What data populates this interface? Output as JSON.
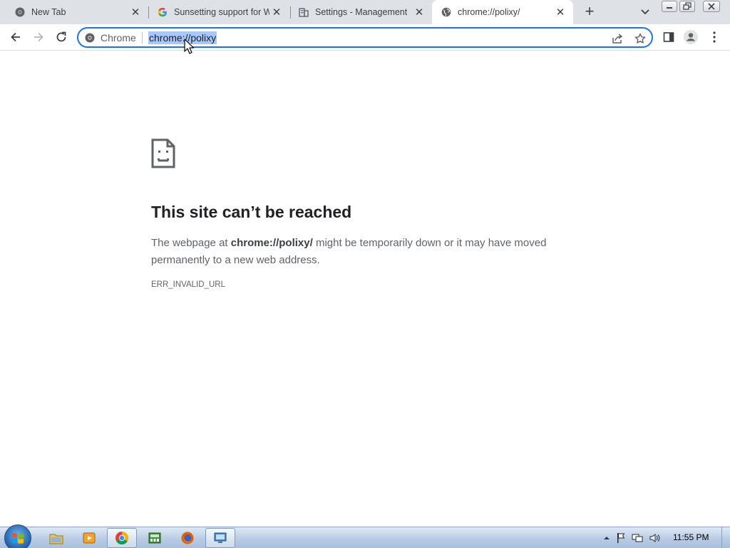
{
  "browser": {
    "tabs": [
      {
        "title": "New Tab",
        "icon": "chrome-icon",
        "active": false
      },
      {
        "title": "Sunsetting support for W",
        "icon": "google-icon",
        "active": false
      },
      {
        "title": "Settings - Management",
        "icon": "building-icon",
        "active": false
      },
      {
        "title": "chrome://polixy/",
        "icon": "globe-icon",
        "active": true
      }
    ],
    "omnibox": {
      "chip_label": "Chrome",
      "url": "chrome://polixy"
    }
  },
  "page": {
    "title": "This site can’t be reached",
    "desc_prefix": "The webpage at ",
    "desc_url": "chrome://polixy/",
    "desc_suffix": " might be temporarily down or it may have moved permanently to a new web address.",
    "error_code": "ERR_INVALID_URL"
  },
  "taskbar": {
    "apps": [
      "explorer-icon",
      "media-player-icon",
      "chrome-icon",
      "calculator-icon",
      "firefox-icon",
      "remote-desktop-icon"
    ],
    "active_app": "chrome-icon",
    "clock": "11:55 PM"
  },
  "colors": {
    "accent": "#1a73e8",
    "selection": "#a8c7fa",
    "tabstrip": "#dee1e6"
  }
}
